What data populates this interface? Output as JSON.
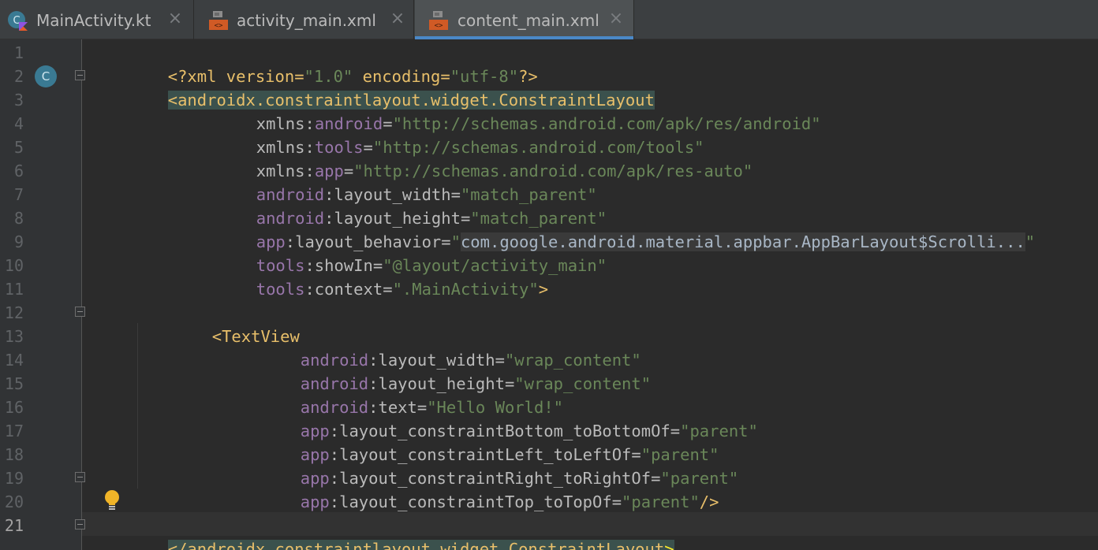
{
  "tabs": [
    {
      "label": "MainActivity.kt",
      "icon": "kotlin-class-icon",
      "active": false
    },
    {
      "label": "activity_main.xml",
      "icon": "layout-xml-icon",
      "active": false
    },
    {
      "label": "content_main.xml",
      "icon": "layout-xml-icon",
      "active": true
    }
  ],
  "tab_close_glyph": "×",
  "gutter": {
    "class_badge_letter": "C",
    "line_numbers": [
      "1",
      "2",
      "3",
      "4",
      "5",
      "6",
      "7",
      "8",
      "9",
      "10",
      "11",
      "12",
      "13",
      "14",
      "15",
      "16",
      "17",
      "18",
      "19",
      "20",
      "21"
    ],
    "current_line": "21"
  },
  "code": {
    "l1": {
      "a": "<?xml version=",
      "b": "\"1.0\"",
      "c": " encoding=",
      "d": "\"utf-8\"",
      "e": "?>"
    },
    "l2": {
      "a": "<androidx.constraintlayout.widget.ConstraintLayout"
    },
    "l3": {
      "a": "xmlns:",
      "b": "android",
      "c": "=",
      "d": "\"http://schemas.android.com/apk/res/android\""
    },
    "l4": {
      "a": "xmlns:",
      "b": "tools",
      "c": "=",
      "d": "\"http://schemas.android.com/tools\""
    },
    "l5": {
      "a": "xmlns:",
      "b": "app",
      "c": "=",
      "d": "\"http://schemas.android.com/apk/res-auto\""
    },
    "l6": {
      "a": "android",
      "b": ":layout_width=",
      "c": "\"match_parent\""
    },
    "l7": {
      "a": "android",
      "b": ":layout_height=",
      "c": "\"match_parent\""
    },
    "l8": {
      "a": "app",
      "b": ":layout_behavior=",
      "c": "\"",
      "d": "com.google.android.material.appbar.AppBarLayout$Scrolli...",
      "e": "\""
    },
    "l9": {
      "a": "tools",
      "b": ":showIn=",
      "c": "\"@layout/activity_main\""
    },
    "l10": {
      "a": "tools",
      "b": ":context=",
      "c": "\".MainActivity\"",
      "d": ">"
    },
    "l12": {
      "a": "<TextView"
    },
    "l13": {
      "a": "android",
      "b": ":layout_width=",
      "c": "\"wrap_content\""
    },
    "l14": {
      "a": "android",
      "b": ":layout_height=",
      "c": "\"wrap_content\""
    },
    "l15": {
      "a": "android",
      "b": ":text=",
      "c": "\"Hello World!\""
    },
    "l16": {
      "a": "app",
      "b": ":layout_constraintBottom_toBottomOf=",
      "c": "\"parent\""
    },
    "l17": {
      "a": "app",
      "b": ":layout_constraintLeft_toLeftOf=",
      "c": "\"parent\""
    },
    "l18": {
      "a": "app",
      "b": ":layout_constraintRight_toRightOf=",
      "c": "\"parent\""
    },
    "l19": {
      "a": "app",
      "b": ":layout_constraintTop_toTopOf=",
      "c": "\"parent\"",
      "d": "/>"
    },
    "l21": {
      "a": "</androidx.constraintlayout.widget.ConstraintLayout",
      "b": ">"
    }
  },
  "colors": {
    "tag": "#e8bf6a",
    "attribute": "#bababa",
    "namespace": "#9876aa",
    "string": "#6a8759",
    "active_tab_underline": "#4a88c7"
  }
}
